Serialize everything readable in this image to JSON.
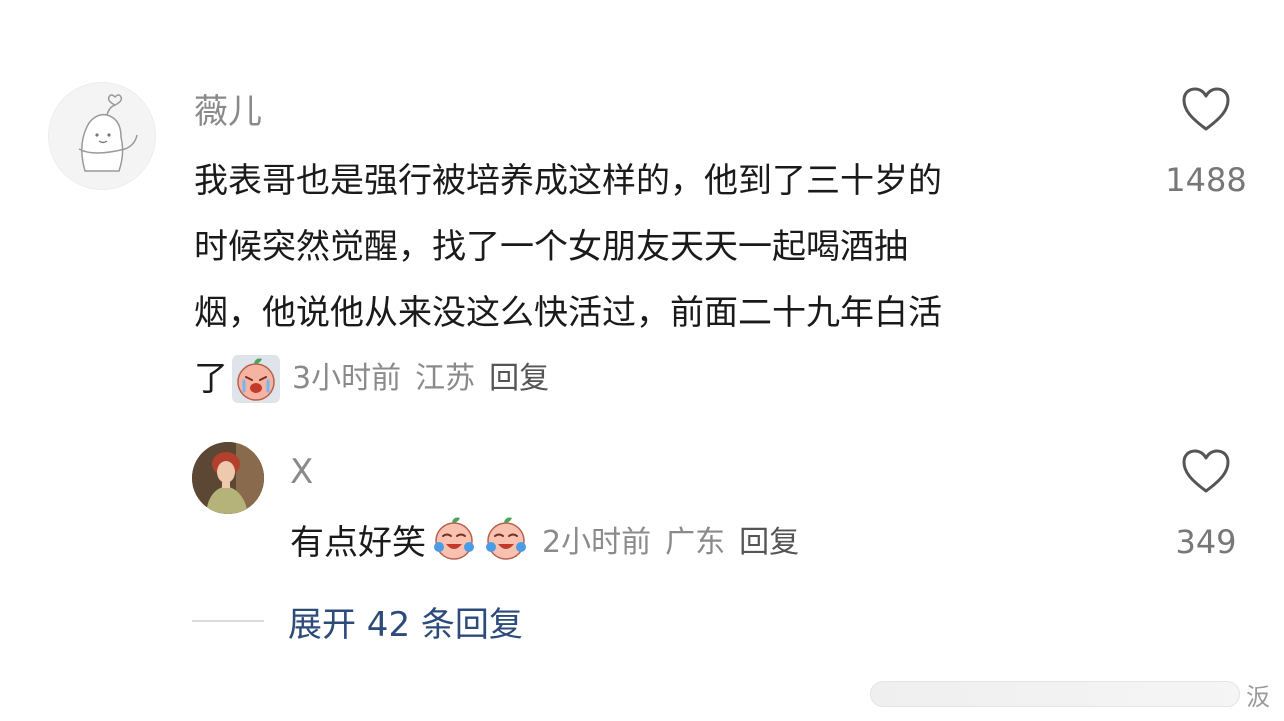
{
  "comments": [
    {
      "username": "薇儿",
      "text_lines": [
        "我表哥也是强行被培养成这样的，他到了三十岁的",
        "时候突然觉醒，找了一个女朋友天天一起喝酒抽",
        "烟，他说他从来没这么快活过，前面二十九年白活",
        "了"
      ],
      "emoji": "crying-face-emoji",
      "time": "3小时前",
      "location": "江苏",
      "reply_label": "回复",
      "like_icon": "heart-outline-icon",
      "like_count": "1488"
    }
  ],
  "reply": {
    "username": "X",
    "text": "有点好笑",
    "emojis": [
      "laughing-tears-emoji",
      "laughing-tears-emoji"
    ],
    "time": "2小时前",
    "location": "广东",
    "reply_label": "回复",
    "like_icon": "heart-outline-icon",
    "like_count": "349"
  },
  "expand_label": "展开 42 条回复",
  "watermark": {
    "char": "汳"
  },
  "colors": {
    "username": "#8a8a8a",
    "meta": "#8a8a8a",
    "expand_link": "#2c4a7a",
    "text": "#1a1a1a"
  }
}
